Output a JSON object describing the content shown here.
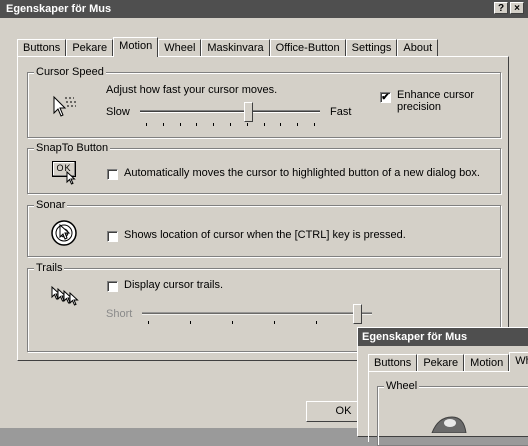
{
  "window": {
    "title": "Egenskaper för Mus",
    "help_btn": "?",
    "close_btn": "×",
    "ok_label": "OK",
    "tabs": [
      "Buttons",
      "Pekare",
      "Motion",
      "Wheel",
      "Maskinvara",
      "Office-Button",
      "Settings",
      "About"
    ],
    "active_tab": "Motion"
  },
  "cursor_speed": {
    "title": "Cursor Speed",
    "description": "Adjust how fast your cursor moves.",
    "slow": "Slow",
    "fast": "Fast",
    "enhance_label": "Enhance cursor\nprecision",
    "enhance_checked": true,
    "speed_fraction": 0.6
  },
  "snapto": {
    "title": "SnapTo Button",
    "icon_text": "OK",
    "label": "Automatically moves the cursor to highlighted button of a new dialog box.",
    "checked": false
  },
  "sonar": {
    "title": "Sonar",
    "label": "Shows location of cursor when the [CTRL] key is pressed.",
    "checked": false
  },
  "trails": {
    "title": "Trails",
    "label": "Display cursor trails.",
    "checked": false,
    "short": "Short"
  },
  "second_window": {
    "title": "Egenskaper för Mus",
    "tabs": [
      "Buttons",
      "Pekare",
      "Motion",
      "Wheel"
    ],
    "group_title": "Wheel"
  }
}
